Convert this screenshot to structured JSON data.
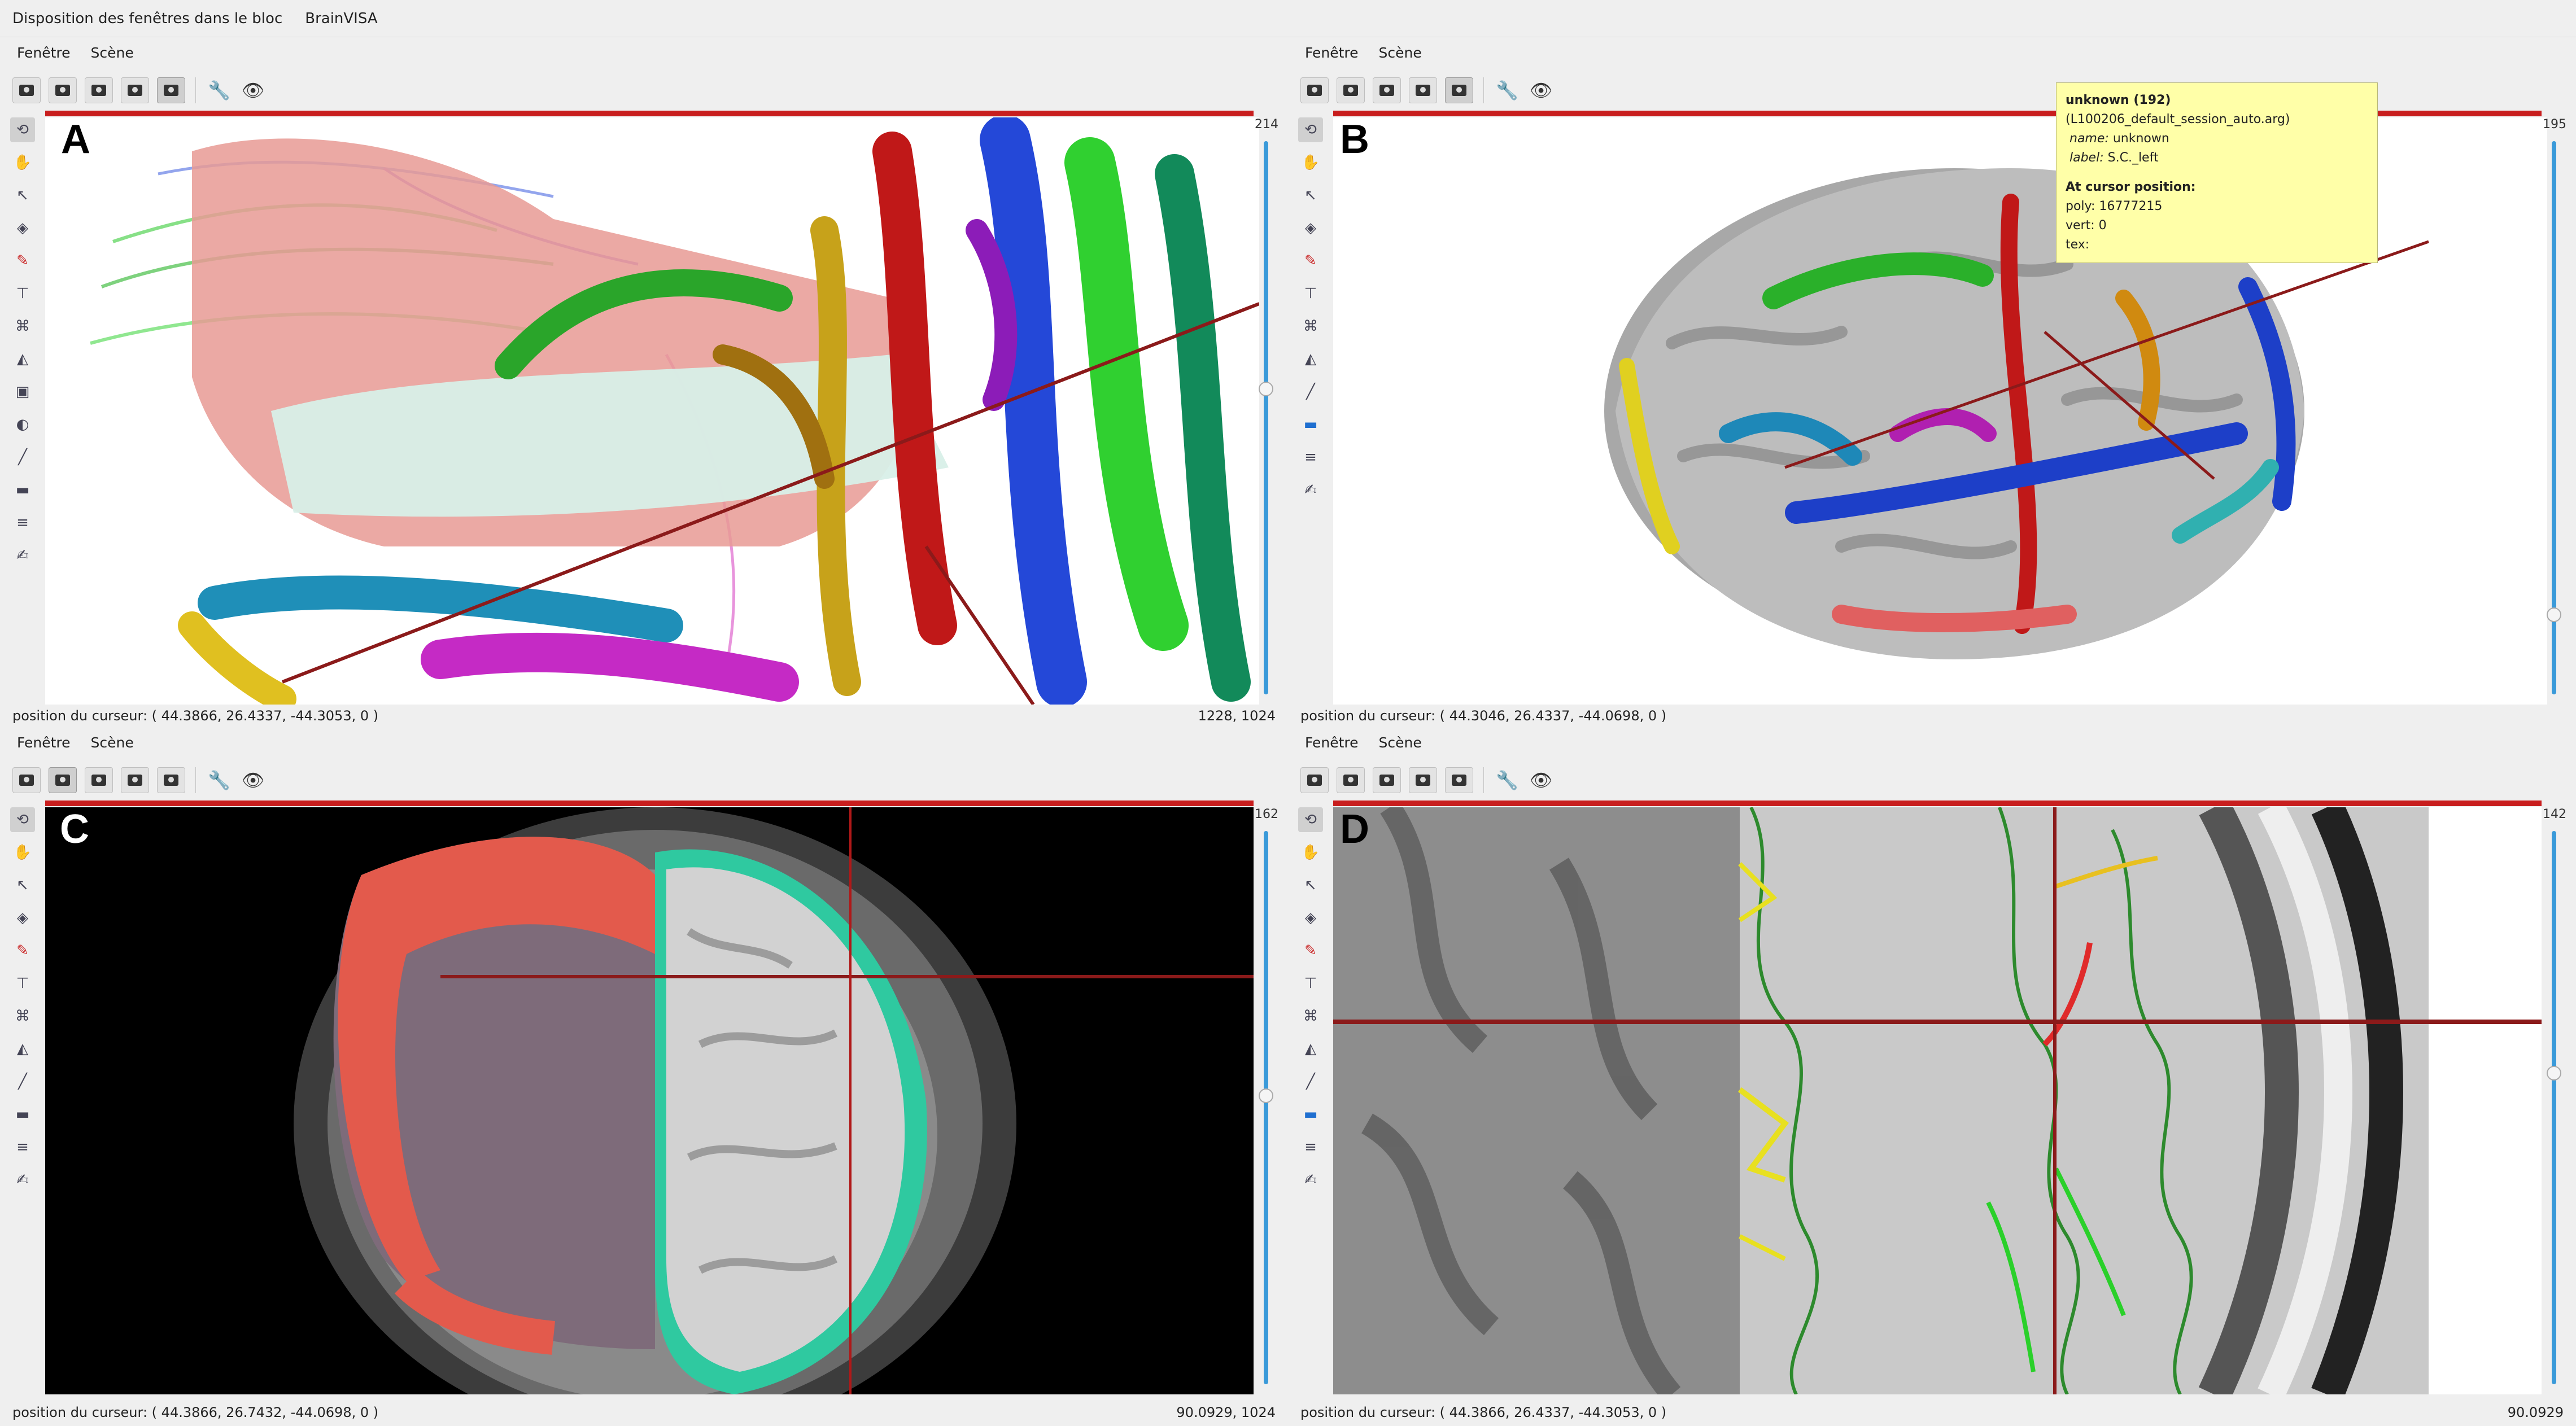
{
  "window": {
    "title": "Disposition des fenêtres dans le bloc",
    "app": "BrainVISA"
  },
  "menu": {
    "fenetre": "Fenêtre",
    "scene": "Scène"
  },
  "panels": {
    "A": {
      "letter": "A",
      "slider_value": "214",
      "cursor_position": "position du curseur: ( 44.3866, 26.4337, -44.3053, 0 )",
      "right_info": "1228, 1024"
    },
    "B": {
      "letter": "B",
      "slider_value": "195",
      "cursor_position": "position du curseur: ( 44.3046, 26.4337, -44.0698, 0 )",
      "right_info": ""
    },
    "C": {
      "letter": "C",
      "slider_value": "162",
      "cursor_position": "position du curseur: ( 44.3866, 26.7432, -44.0698, 0 )",
      "right_info": "90.0929, 1024"
    },
    "D": {
      "letter": "D",
      "slider_value": "142",
      "cursor_position": "position du curseur: ( 44.3866, 26.4337, -44.3053, 0 )",
      "right_info": "90.0929"
    }
  },
  "tooltip": {
    "title": "unknown (192)",
    "source": "(L100206_default_session_auto.arg)",
    "name_key": "name:",
    "name_val": "unknown",
    "label_key": "label:",
    "label_val": "S.C._left",
    "section": "At cursor position:",
    "poly": "poly: 16777215",
    "vert": "vert: 0",
    "tex": "tex:"
  },
  "icons": {
    "toolbar": [
      "camera-icon",
      "camera-icon",
      "camera-icon",
      "camera-icon",
      "camera-icon",
      "wrench-icon",
      "eye-icon"
    ],
    "sidebar": [
      "rotate-icon",
      "pan-icon",
      "select-icon",
      "navigate-icon",
      "paint-icon",
      "ruler-icon",
      "roi-icon",
      "transform-icon",
      "bucket-icon",
      "erase-icon",
      "line-icon",
      "folder-icon",
      "layers-icon",
      "annotate-icon"
    ]
  },
  "colors": {
    "accent_red": "#c81e1e",
    "slider_blue": "#3a9ad9",
    "tooltip_bg": "#ffffa8"
  }
}
